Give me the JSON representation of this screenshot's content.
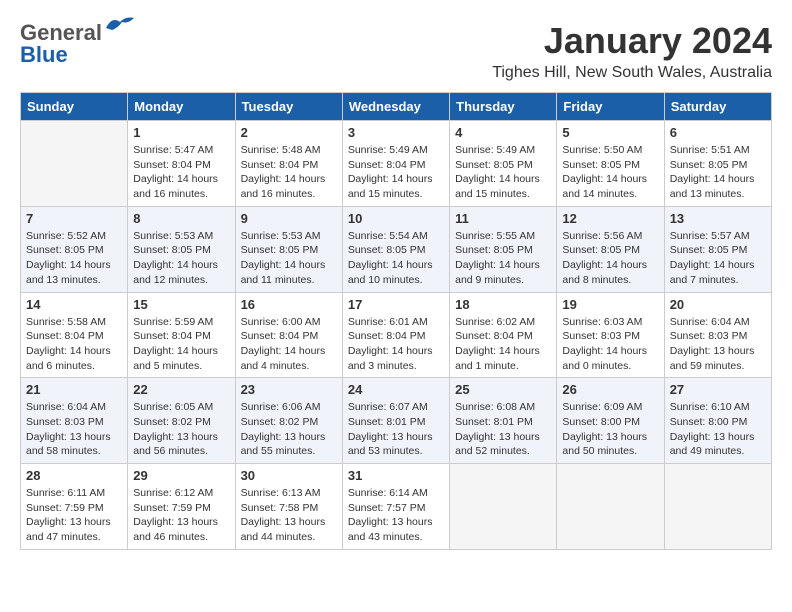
{
  "app": {
    "logo_general": "General",
    "logo_blue": "Blue",
    "month": "January 2024",
    "location": "Tighes Hill, New South Wales, Australia"
  },
  "calendar": {
    "days_of_week": [
      "Sunday",
      "Monday",
      "Tuesday",
      "Wednesday",
      "Thursday",
      "Friday",
      "Saturday"
    ],
    "weeks": [
      [
        {
          "day": "",
          "info": ""
        },
        {
          "day": "1",
          "info": "Sunrise: 5:47 AM\nSunset: 8:04 PM\nDaylight: 14 hours\nand 16 minutes."
        },
        {
          "day": "2",
          "info": "Sunrise: 5:48 AM\nSunset: 8:04 PM\nDaylight: 14 hours\nand 16 minutes."
        },
        {
          "day": "3",
          "info": "Sunrise: 5:49 AM\nSunset: 8:04 PM\nDaylight: 14 hours\nand 15 minutes."
        },
        {
          "day": "4",
          "info": "Sunrise: 5:49 AM\nSunset: 8:05 PM\nDaylight: 14 hours\nand 15 minutes."
        },
        {
          "day": "5",
          "info": "Sunrise: 5:50 AM\nSunset: 8:05 PM\nDaylight: 14 hours\nand 14 minutes."
        },
        {
          "day": "6",
          "info": "Sunrise: 5:51 AM\nSunset: 8:05 PM\nDaylight: 14 hours\nand 13 minutes."
        }
      ],
      [
        {
          "day": "7",
          "info": "Sunrise: 5:52 AM\nSunset: 8:05 PM\nDaylight: 14 hours\nand 13 minutes."
        },
        {
          "day": "8",
          "info": "Sunrise: 5:53 AM\nSunset: 8:05 PM\nDaylight: 14 hours\nand 12 minutes."
        },
        {
          "day": "9",
          "info": "Sunrise: 5:53 AM\nSunset: 8:05 PM\nDaylight: 14 hours\nand 11 minutes."
        },
        {
          "day": "10",
          "info": "Sunrise: 5:54 AM\nSunset: 8:05 PM\nDaylight: 14 hours\nand 10 minutes."
        },
        {
          "day": "11",
          "info": "Sunrise: 5:55 AM\nSunset: 8:05 PM\nDaylight: 14 hours\nand 9 minutes."
        },
        {
          "day": "12",
          "info": "Sunrise: 5:56 AM\nSunset: 8:05 PM\nDaylight: 14 hours\nand 8 minutes."
        },
        {
          "day": "13",
          "info": "Sunrise: 5:57 AM\nSunset: 8:05 PM\nDaylight: 14 hours\nand 7 minutes."
        }
      ],
      [
        {
          "day": "14",
          "info": "Sunrise: 5:58 AM\nSunset: 8:04 PM\nDaylight: 14 hours\nand 6 minutes."
        },
        {
          "day": "15",
          "info": "Sunrise: 5:59 AM\nSunset: 8:04 PM\nDaylight: 14 hours\nand 5 minutes."
        },
        {
          "day": "16",
          "info": "Sunrise: 6:00 AM\nSunset: 8:04 PM\nDaylight: 14 hours\nand 4 minutes."
        },
        {
          "day": "17",
          "info": "Sunrise: 6:01 AM\nSunset: 8:04 PM\nDaylight: 14 hours\nand 3 minutes."
        },
        {
          "day": "18",
          "info": "Sunrise: 6:02 AM\nSunset: 8:04 PM\nDaylight: 14 hours\nand 1 minute."
        },
        {
          "day": "19",
          "info": "Sunrise: 6:03 AM\nSunset: 8:03 PM\nDaylight: 14 hours\nand 0 minutes."
        },
        {
          "day": "20",
          "info": "Sunrise: 6:04 AM\nSunset: 8:03 PM\nDaylight: 13 hours\nand 59 minutes."
        }
      ],
      [
        {
          "day": "21",
          "info": "Sunrise: 6:04 AM\nSunset: 8:03 PM\nDaylight: 13 hours\nand 58 minutes."
        },
        {
          "day": "22",
          "info": "Sunrise: 6:05 AM\nSunset: 8:02 PM\nDaylight: 13 hours\nand 56 minutes."
        },
        {
          "day": "23",
          "info": "Sunrise: 6:06 AM\nSunset: 8:02 PM\nDaylight: 13 hours\nand 55 minutes."
        },
        {
          "day": "24",
          "info": "Sunrise: 6:07 AM\nSunset: 8:01 PM\nDaylight: 13 hours\nand 53 minutes."
        },
        {
          "day": "25",
          "info": "Sunrise: 6:08 AM\nSunset: 8:01 PM\nDaylight: 13 hours\nand 52 minutes."
        },
        {
          "day": "26",
          "info": "Sunrise: 6:09 AM\nSunset: 8:00 PM\nDaylight: 13 hours\nand 50 minutes."
        },
        {
          "day": "27",
          "info": "Sunrise: 6:10 AM\nSunset: 8:00 PM\nDaylight: 13 hours\nand 49 minutes."
        }
      ],
      [
        {
          "day": "28",
          "info": "Sunrise: 6:11 AM\nSunset: 7:59 PM\nDaylight: 13 hours\nand 47 minutes."
        },
        {
          "day": "29",
          "info": "Sunrise: 6:12 AM\nSunset: 7:59 PM\nDaylight: 13 hours\nand 46 minutes."
        },
        {
          "day": "30",
          "info": "Sunrise: 6:13 AM\nSunset: 7:58 PM\nDaylight: 13 hours\nand 44 minutes."
        },
        {
          "day": "31",
          "info": "Sunrise: 6:14 AM\nSunset: 7:57 PM\nDaylight: 13 hours\nand 43 minutes."
        },
        {
          "day": "",
          "info": ""
        },
        {
          "day": "",
          "info": ""
        },
        {
          "day": "",
          "info": ""
        }
      ]
    ]
  }
}
